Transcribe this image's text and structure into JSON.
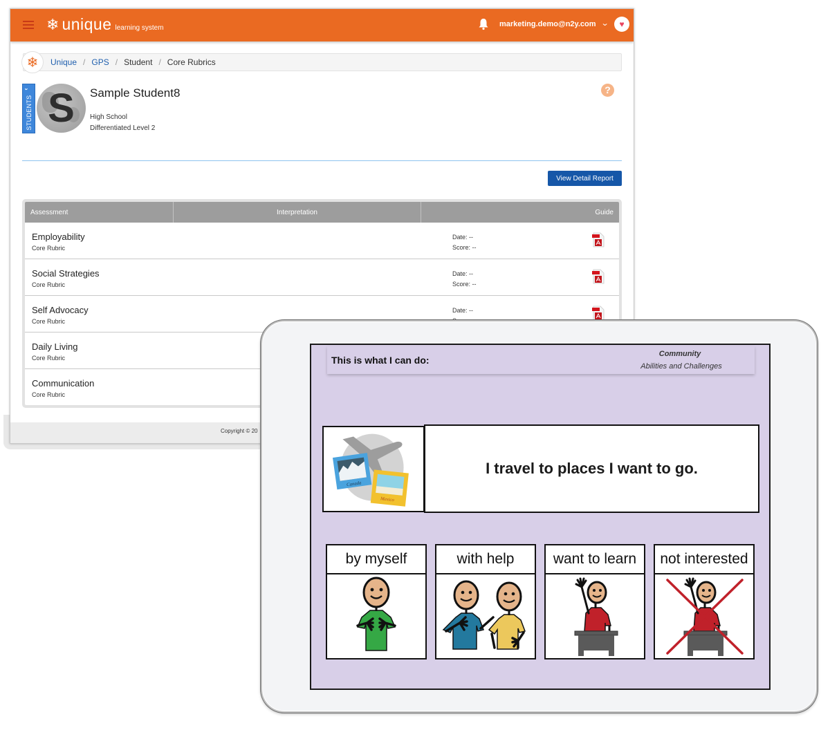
{
  "app": {
    "logo_text": "unique",
    "logo_subtext": "learning system",
    "user_email": "marketing.demo@n2y.com",
    "brand_color": "#ea6a22",
    "icons": {
      "menu": "hamburger-icon",
      "logo": "snowflake-icon",
      "notifications": "bell-icon",
      "user_menu": "chevron-down-icon",
      "avatar": "heart-icon"
    }
  },
  "breadcrumb": [
    {
      "label": "Unique",
      "link": true
    },
    {
      "label": "GPS",
      "link": true
    },
    {
      "label": "Student",
      "link": false
    },
    {
      "label": "Core Rubrics",
      "link": false
    }
  ],
  "student": {
    "tab_label": "STUDENTS",
    "initial": "S",
    "name": "Sample Student8",
    "school": "High School",
    "level": "Differentiated Level 2"
  },
  "actions": {
    "view_detail_report": "View Detail Report",
    "help": "?"
  },
  "table": {
    "columns": [
      "Assessment",
      "Interpretation",
      "Guide"
    ],
    "rows": [
      {
        "name": "Employability",
        "type": "Core Rubric",
        "date": "Date: --",
        "score": "Score: --",
        "guide": "pdf-icon"
      },
      {
        "name": "Social Strategies",
        "type": "Core Rubric",
        "date": "Date: --",
        "score": "Score: --",
        "guide": "pdf-icon"
      },
      {
        "name": "Self Advocacy",
        "type": "Core Rubric",
        "date": "Date: --",
        "score": "Score: --",
        "guide": "pdf-icon"
      },
      {
        "name": "Daily Living",
        "type": "Core Rubric",
        "date": "",
        "score": "",
        "guide": ""
      },
      {
        "name": "Communication",
        "type": "Core Rubric",
        "date": "",
        "score": "",
        "guide": ""
      }
    ]
  },
  "footer": {
    "copyright": "Copyright © 20"
  },
  "tablet": {
    "header_title": "This is what I can do:",
    "category": "Community",
    "subcategory": "Abilities and Challenges",
    "statement": "I travel to places I want to go.",
    "statement_image": "travel-photos-airplane",
    "choices": [
      {
        "label": "by myself",
        "icon": "person-self-icon"
      },
      {
        "label": "with help",
        "icon": "people-helping-icon"
      },
      {
        "label": "want to learn",
        "icon": "student-raising-hand-icon"
      },
      {
        "label": "not interested",
        "icon": "crossed-out-student-icon"
      }
    ],
    "screen_color": "#d8cfe8"
  }
}
